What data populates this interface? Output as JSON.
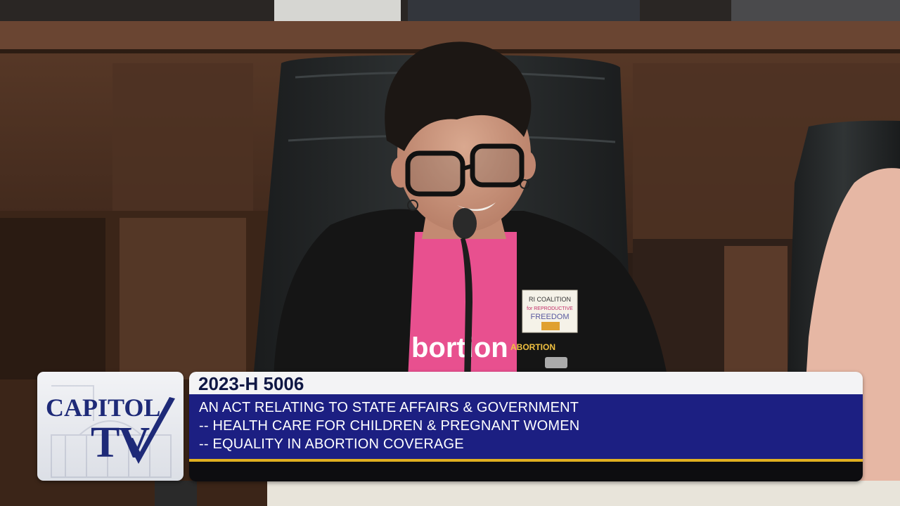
{
  "broadcast": {
    "logo": {
      "line1": "CAPITOL",
      "line2": "TV"
    },
    "bill": {
      "number": "2023-H 5006",
      "lines": [
        "AN ACT RELATING TO STATE AFFAIRS & GOVERNMENT",
        "-- HEALTH CARE FOR CHILDREN & PREGNANT WOMEN",
        "-- EQUALITY IN ABORTION COVERAGE"
      ]
    }
  },
  "scene": {
    "shirt_text": "bortion",
    "pin_text": "ABORTION",
    "badge": {
      "line1": "RI COALITION",
      "line2": "for REPRODUCTIVE",
      "line3": "FREEDOM"
    }
  },
  "colors": {
    "navy_bar": "#1c1f82",
    "gold_rule": "#e0b020",
    "logo_text": "#1e2a78",
    "shirt_pink": "#e8508f"
  }
}
